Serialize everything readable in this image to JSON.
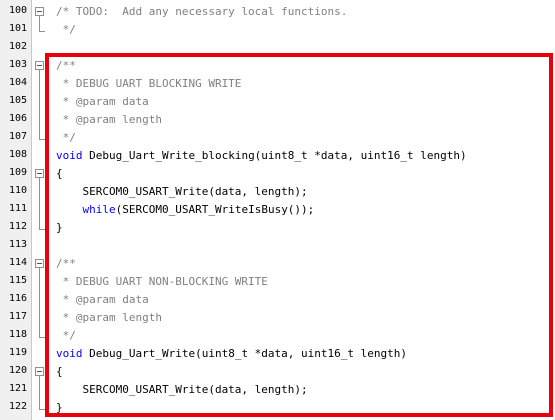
{
  "colors": {
    "comment": "#808080",
    "keyword": "#0000ff",
    "text": "#000000",
    "gutter_bg": "#f0f0f0",
    "highlight": "#e8000b"
  },
  "lines": [
    {
      "num": "100",
      "fold": "box",
      "segments": [
        {
          "text": "/* TODO:  Add any necessary local functions.",
          "cls": "comment"
        }
      ]
    },
    {
      "num": "101",
      "fold": "end",
      "segments": [
        {
          "text": " */",
          "cls": "comment"
        }
      ]
    },
    {
      "num": "102",
      "fold": "",
      "segments": []
    },
    {
      "num": "103",
      "fold": "box",
      "segments": [
        {
          "text": "/**",
          "cls": "comment"
        }
      ]
    },
    {
      "num": "104",
      "fold": "line",
      "segments": [
        {
          "text": " * DEBUG UART BLOCKING WRITE",
          "cls": "comment"
        }
      ]
    },
    {
      "num": "105",
      "fold": "line",
      "segments": [
        {
          "text": " * @param data",
          "cls": "comment"
        }
      ]
    },
    {
      "num": "106",
      "fold": "line",
      "segments": [
        {
          "text": " * @param length",
          "cls": "comment"
        }
      ]
    },
    {
      "num": "107",
      "fold": "end",
      "segments": [
        {
          "text": " */",
          "cls": "comment"
        }
      ]
    },
    {
      "num": "108",
      "fold": "",
      "segments": [
        {
          "text": "void",
          "cls": "keyword"
        },
        {
          "text": " Debug_Uart_Write_blocking(uint8_t *data, uint16_t length)",
          "cls": "text"
        }
      ]
    },
    {
      "num": "109",
      "fold": "box",
      "segments": [
        {
          "text": "{",
          "cls": "text"
        }
      ]
    },
    {
      "num": "110",
      "fold": "line",
      "segments": [
        {
          "text": "    SERCOM0_USART_Write(data, length);",
          "cls": "text"
        }
      ]
    },
    {
      "num": "111",
      "fold": "line",
      "segments": [
        {
          "text": "    ",
          "cls": "text"
        },
        {
          "text": "while",
          "cls": "keyword"
        },
        {
          "text": "(SERCOM0_USART_WriteIsBusy());",
          "cls": "text"
        }
      ]
    },
    {
      "num": "112",
      "fold": "end",
      "segments": [
        {
          "text": "}",
          "cls": "text"
        }
      ]
    },
    {
      "num": "113",
      "fold": "",
      "segments": []
    },
    {
      "num": "114",
      "fold": "box",
      "segments": [
        {
          "text": "/**",
          "cls": "comment"
        }
      ]
    },
    {
      "num": "115",
      "fold": "line",
      "segments": [
        {
          "text": " * DEBUG UART NON-BLOCKING WRITE",
          "cls": "comment"
        }
      ]
    },
    {
      "num": "116",
      "fold": "line",
      "segments": [
        {
          "text": " * @param data",
          "cls": "comment"
        }
      ]
    },
    {
      "num": "117",
      "fold": "line",
      "segments": [
        {
          "text": " * @param length",
          "cls": "comment"
        }
      ]
    },
    {
      "num": "118",
      "fold": "end",
      "segments": [
        {
          "text": " */",
          "cls": "comment"
        }
      ]
    },
    {
      "num": "119",
      "fold": "",
      "segments": [
        {
          "text": "void",
          "cls": "keyword"
        },
        {
          "text": " Debug_Uart_Write(uint8_t *data, uint16_t length)",
          "cls": "text"
        }
      ]
    },
    {
      "num": "120",
      "fold": "box",
      "segments": [
        {
          "text": "{",
          "cls": "text"
        }
      ]
    },
    {
      "num": "121",
      "fold": "line",
      "segments": [
        {
          "text": "    SERCOM0_USART_Write(data, length);",
          "cls": "text"
        }
      ]
    },
    {
      "num": "122",
      "fold": "end",
      "segments": [
        {
          "text": "}",
          "cls": "text"
        }
      ]
    }
  ]
}
